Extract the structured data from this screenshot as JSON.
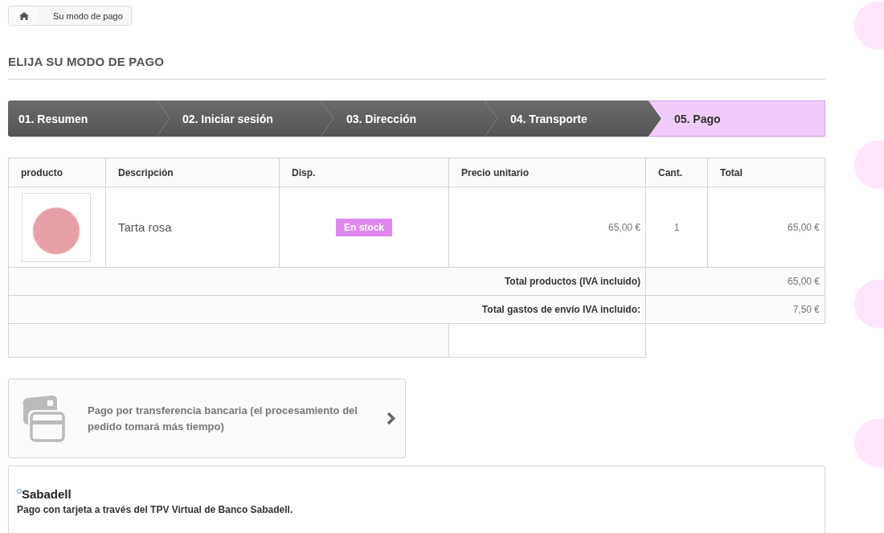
{
  "breadcrumb": {
    "items": [
      "Su modo de pago"
    ]
  },
  "heading": "ELIJA SU MODO DE PAGO",
  "steps": [
    {
      "label": "01. Resumen",
      "selected": false
    },
    {
      "label": "02. Iniciar sesión",
      "selected": false
    },
    {
      "label": "03. Dirección",
      "selected": false
    },
    {
      "label": "04. Transporte",
      "selected": false
    },
    {
      "label": "05. Pago",
      "selected": true
    }
  ],
  "table": {
    "columns": [
      "producto",
      "Descripción",
      "Disp.",
      "Precio unitario",
      "Cant.",
      "Total"
    ],
    "rows": [
      {
        "description": "Tarta rosa",
        "availability": "En stock",
        "unit_price": "65,00 €",
        "quantity": "1",
        "total": "65,00 €"
      }
    ],
    "summary": [
      {
        "label": "Total productos (IVA incluido)",
        "value": "65,00 €"
      },
      {
        "label": "Total gastos de envío IVA incluido:",
        "value": "7,50 €"
      }
    ]
  },
  "payment_options": [
    {
      "text": "**Pago por transferencia bancaria** (el procesamiento del pedido tomará más tiempo)"
    }
  ],
  "sabadell": {
    "title": "Sabadell",
    "description": "Pago con tarjeta a través del TPV Virtual de Banco Sabadell."
  }
}
